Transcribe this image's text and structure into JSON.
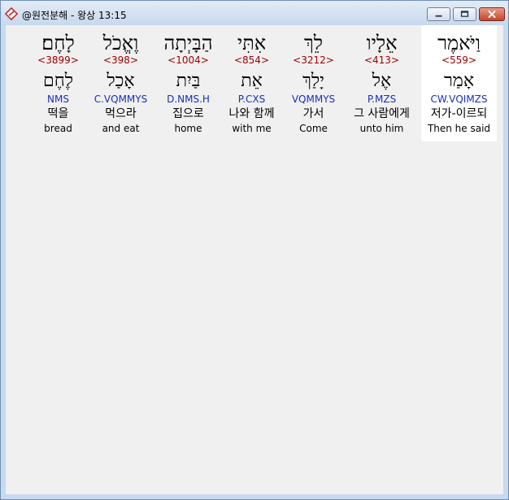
{
  "window": {
    "title": "@원전분해 - 왕상 13:15"
  },
  "colors": {
    "strong_number": "#a00000",
    "parsing_code": "#1a2fb8",
    "selected_background": "#ffffff"
  },
  "icons": {
    "app": "app-icon",
    "minimize": "minimize-icon",
    "maximize": "maximize-icon",
    "close": "close-icon"
  },
  "words": [
    {
      "hebrew": "וַיֹּאמֶר",
      "strong": "<559>",
      "root": "אָמַר",
      "parse": "CW.VQIMZS",
      "korean": "저가-이르되",
      "english": "Then he said",
      "selected": true
    },
    {
      "hebrew": "אֵלָיו",
      "strong": "<413>",
      "root": "אֶל",
      "parse": "P.MZS",
      "korean": "그 사람에게",
      "english": "unto him",
      "selected": false
    },
    {
      "hebrew": "לֵךְ",
      "strong": "<3212>",
      "root": "יָלַךְ",
      "parse": "VQMMYS",
      "korean": "가서",
      "english": "Come",
      "selected": false
    },
    {
      "hebrew": "אִתִּי",
      "strong": "<854>",
      "root": "אֵת",
      "parse": "P.CXS",
      "korean": "나와 함께",
      "english": "with me",
      "selected": false
    },
    {
      "hebrew": "הַבָּיְתָה",
      "strong": "<1004>",
      "root": "בַּיִת",
      "parse": "D.NMS.H",
      "korean": "집으로",
      "english": "home",
      "selected": false
    },
    {
      "hebrew": "וֶאֱכֹל",
      "strong": "<398>",
      "root": "אָכַל",
      "parse": "C.VQMMYS",
      "korean": "먹으라",
      "english": "and eat",
      "selected": false
    },
    {
      "hebrew": "לָחֶם׃",
      "strong": "<3899>",
      "root": "לֶחֶם",
      "parse": "NMS",
      "korean": "떡을",
      "english": "bread",
      "selected": false
    }
  ]
}
